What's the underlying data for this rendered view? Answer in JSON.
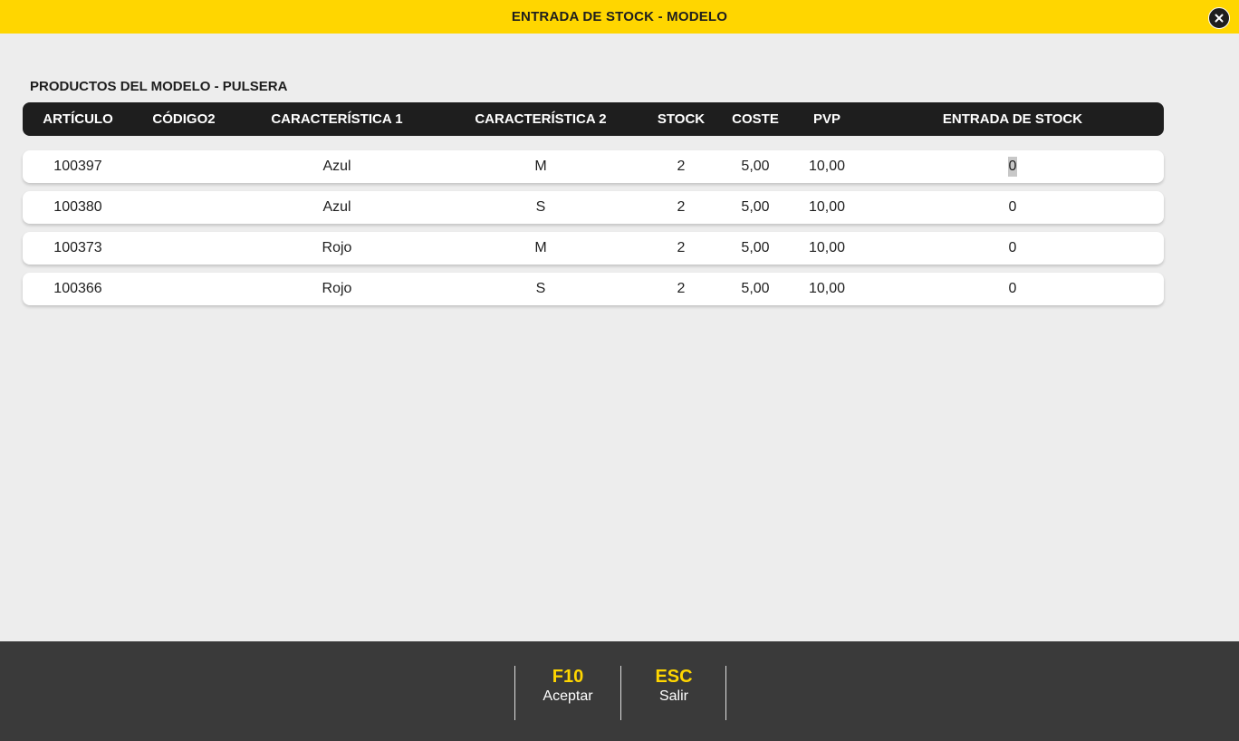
{
  "window": {
    "title": "ENTRADA DE STOCK - MODELO",
    "close_icon": "close-icon",
    "accent_color": "#ffd600",
    "dark_color": "#1e1e1e"
  },
  "section": {
    "title": "PRODUCTOS DEL MODELO - PULSERA"
  },
  "table": {
    "headers": {
      "articulo": "ARTÍCULO",
      "codigo2": "CÓDIGO2",
      "caracteristica1": "CARACTERÍSTICA 1",
      "caracteristica2": "CARACTERÍSTICA 2",
      "stock": "STOCK",
      "coste": "COSTE",
      "pvp": "PVP",
      "entrada": "ENTRADA DE STOCK"
    },
    "rows": [
      {
        "articulo": "100397",
        "codigo2": "",
        "caracteristica1": "Azul",
        "caracteristica2": "M",
        "stock": "2",
        "coste": "5,00",
        "pvp": "10,00",
        "entrada": "0"
      },
      {
        "articulo": "100380",
        "codigo2": "",
        "caracteristica1": "Azul",
        "caracteristica2": "S",
        "stock": "2",
        "coste": "5,00",
        "pvp": "10,00",
        "entrada": "0"
      },
      {
        "articulo": "100373",
        "codigo2": "",
        "caracteristica1": "Rojo",
        "caracteristica2": "M",
        "stock": "2",
        "coste": "5,00",
        "pvp": "10,00",
        "entrada": "0"
      },
      {
        "articulo": "100366",
        "codigo2": "",
        "caracteristica1": "Rojo",
        "caracteristica2": "S",
        "stock": "2",
        "coste": "5,00",
        "pvp": "10,00",
        "entrada": "0"
      }
    ]
  },
  "footer": {
    "accept": {
      "key": "F10",
      "label": "Aceptar"
    },
    "exit": {
      "key": "ESC",
      "label": "Salir"
    }
  }
}
